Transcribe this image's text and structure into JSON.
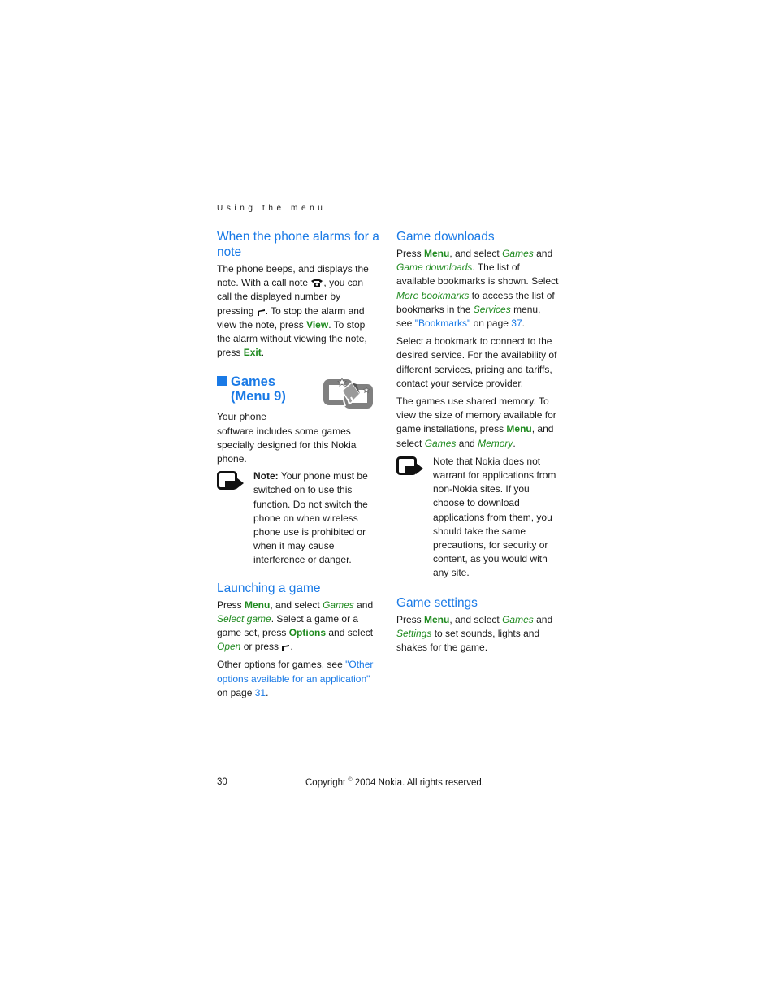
{
  "running_head": "Using the menu",
  "left": {
    "alarm": {
      "title": "When the phone alarms for a note",
      "p1": [
        "The phone beeps, and displays the note. With a call note ",
        ", you can call the displayed number by pressing ",
        ". To stop the alarm and view the note, press ",
        "View",
        ". To stop the alarm without viewing the note, press ",
        "Exit",
        "."
      ]
    },
    "games": {
      "title_line1": "Games",
      "title_line2": "(Menu 9)",
      "icon": "games-menu-icon",
      "intro": "Your phone software includes some games specially designed for this Nokia phone.",
      "note_label": "Note:",
      "note_text": " Your phone must be switched on to use this function. Do not switch the phone on when wireless phone use is prohibited or when it may cause interference or danger."
    },
    "launching": {
      "title": "Launching a game",
      "p1": [
        "Press ",
        "Menu",
        ", and select ",
        "Games",
        " and ",
        "Select game",
        ". Select a game or a game set, press ",
        "Options",
        " and select ",
        "Open",
        " or press ",
        "."
      ],
      "p2": [
        "Other options for games, see ",
        "\"Other options available for an application\"",
        " on page ",
        "31",
        "."
      ]
    }
  },
  "right": {
    "downloads": {
      "title": "Game downloads",
      "p1": [
        "Press ",
        "Menu",
        ", and select ",
        "Games",
        " and ",
        "Game downloads",
        ". The list of available bookmarks is shown. Select ",
        "More bookmarks",
        " to access the list of bookmarks in the ",
        "Services",
        " menu, see ",
        "\"Bookmarks\"",
        " on page ",
        "37",
        "."
      ],
      "p2": "Select a bookmark to connect to the desired service. For the availability of different services, pricing and tariffs, contact your service provider.",
      "p3": [
        "The games use shared memory. To view the size of memory available for game installations, press ",
        "Menu",
        ", and select ",
        "Games",
        " and ",
        "Memory",
        "."
      ],
      "note_text": "Note that Nokia does not warrant for applications from non-Nokia sites. If you choose to download applications from them, you should take the same precautions, for security or content, as you would with any site."
    },
    "settings": {
      "title": "Game settings",
      "p1": [
        "Press ",
        "Menu",
        ", and select ",
        "Games",
        " and ",
        "Settings",
        " to set sounds, lights and shakes for the game."
      ]
    }
  },
  "footer": {
    "page_number": "30",
    "copyright_pre": "Copyright ",
    "copyright_sym": "©",
    "copyright_post": " 2004 Nokia. All rights reserved."
  },
  "colors": {
    "heading_blue": "#1a7ae6",
    "ui_green": "#1f8a1f"
  }
}
